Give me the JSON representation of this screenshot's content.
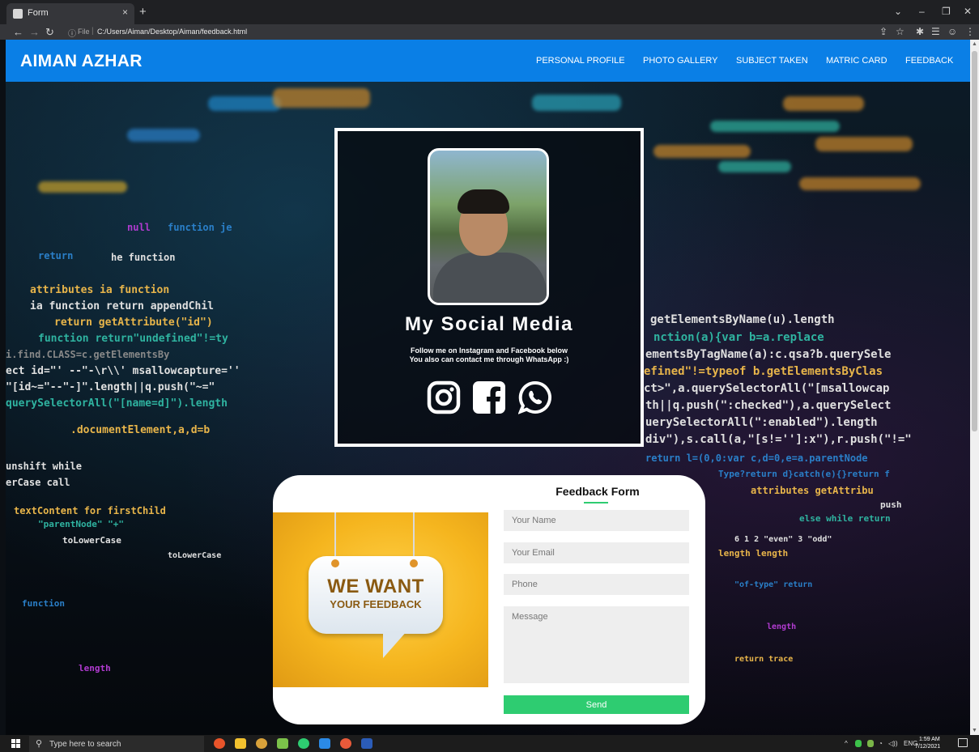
{
  "browser": {
    "tab_title": "Form",
    "tab_close": "×",
    "new_tab": "+",
    "omnibox_scheme": "File",
    "omnibox_url": "C:/Users/Aiman/Desktop/Aiman/feedback.html",
    "window_controls": {
      "dropdown": "⌄",
      "minimize": "–",
      "restore": "❐",
      "close": "✕"
    }
  },
  "header": {
    "brand": "AIMAN AZHAR",
    "nav": [
      "PERSONAL PROFILE",
      "PHOTO GALLERY",
      "SUBJECT TAKEN",
      "MATRIC CARD",
      "FEEDBACK"
    ]
  },
  "social": {
    "title": "My Social Media",
    "line1": "Follow me on Instagram and Facebook below",
    "line2": "You also can contact me through WhatsApp :)",
    "icons": [
      "instagram-icon",
      "facebook-icon",
      "whatsapp-icon"
    ]
  },
  "feedback": {
    "title": "Feedback Form",
    "promo_line1": "WE WANT",
    "promo_line2": "YOUR FEEDBACK",
    "fields": {
      "name_placeholder": "Your Name",
      "email_placeholder": "Your Email",
      "phone_placeholder": "Phone",
      "message_placeholder": "Message"
    },
    "send_label": "Send"
  },
  "taskbar": {
    "search_placeholder": "Type here to search",
    "lang": "ENG",
    "time": "1:59 AM",
    "date": "7/12/2021"
  },
  "colors": {
    "header_blue": "#0a7fe6",
    "accent_green": "#2ecc71",
    "promo_yellow": "#f5b51e"
  }
}
